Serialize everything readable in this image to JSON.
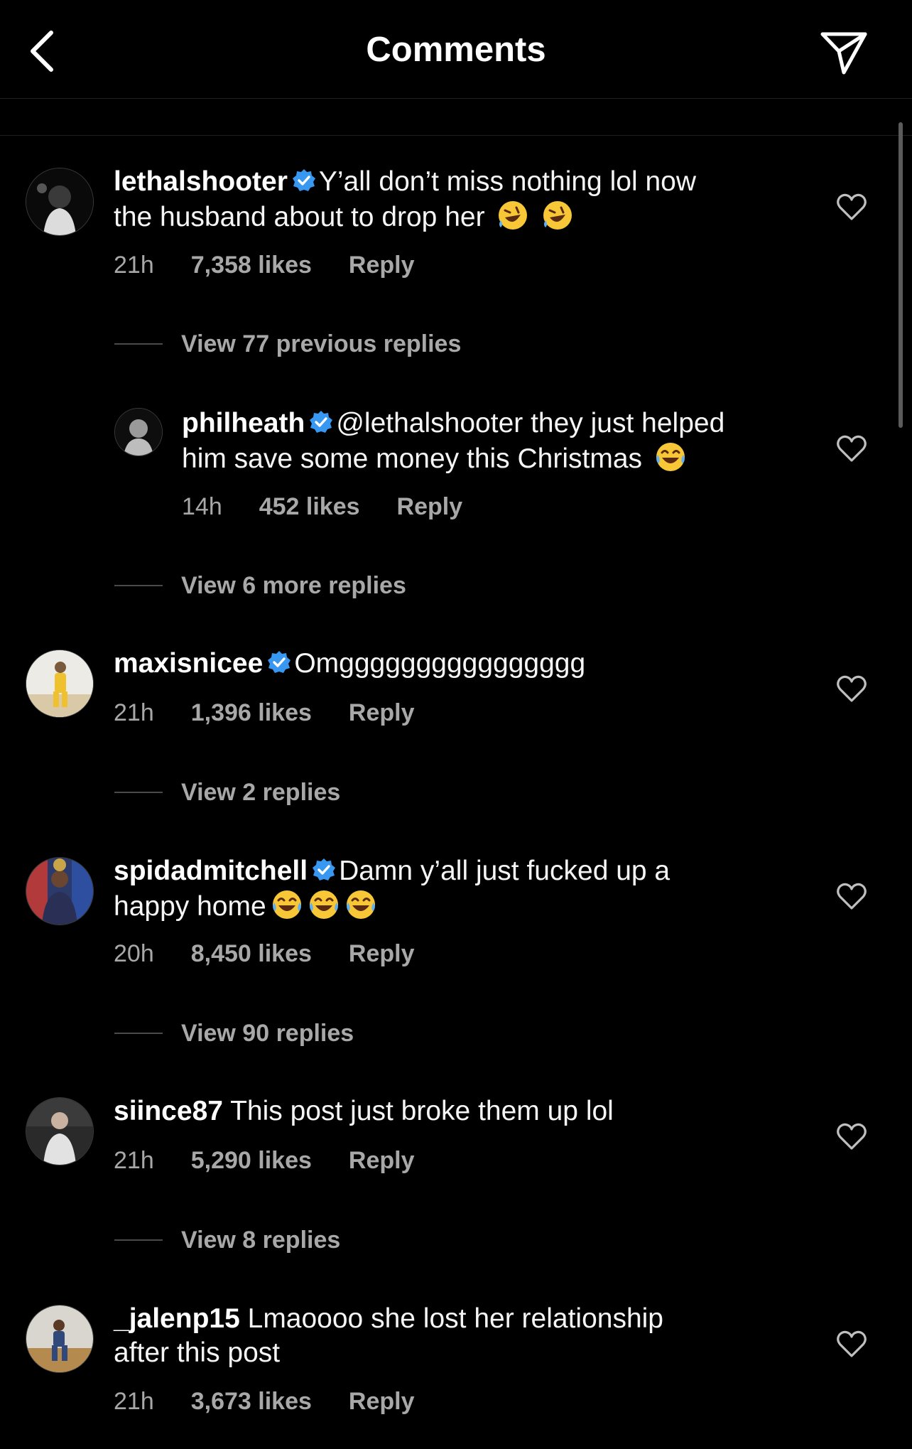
{
  "header": {
    "title": "Comments"
  },
  "comments": [
    {
      "username": "lethalshooter",
      "verified": true,
      "text_line1": "Y’all don’t miss nothing lol now",
      "text_line2": "the husband about to drop her",
      "emojis": [
        "rolling-on-floor-laughing",
        "rolling-on-floor-laughing"
      ],
      "time": "21h",
      "likes": "7,358 likes",
      "reply": "Reply",
      "view_replies": "View 77 previous replies"
    },
    {
      "username": "philheath",
      "verified": true,
      "text_line1": "@lethalshooter they just helped",
      "text_line2": "him save some money this Christmas",
      "emojis": [
        "tears-of-joy"
      ],
      "time": "14h",
      "likes": "452 likes",
      "reply": "Reply",
      "view_replies": "View 6 more replies"
    },
    {
      "username": "maxisnicee",
      "verified": true,
      "text_line1": "Omgggggggggggggggg",
      "time": "21h",
      "likes": "1,396 likes",
      "reply": "Reply",
      "view_replies": "View 2 replies"
    },
    {
      "username": "spidadmitchell",
      "verified": true,
      "text_line1": "Damn y’all just fucked up a",
      "text_line2": "happy home",
      "emojis": [
        "tears-of-joy",
        "tears-of-joy",
        "tears-of-joy"
      ],
      "time": "20h",
      "likes": "8,450 likes",
      "reply": "Reply",
      "view_replies": "View 90 replies"
    },
    {
      "username": "siince87",
      "verified": false,
      "text_line1": "This post just broke them up lol",
      "time": "21h",
      "likes": "5,290 likes",
      "reply": "Reply",
      "view_replies": "View 8 replies"
    },
    {
      "username": "_jalenp15",
      "verified": false,
      "text_line1": "Lmaoooo she lost her relationship",
      "text_line2": "after this post",
      "time": "21h",
      "likes": "3,673 likes",
      "reply": "Reply"
    }
  ],
  "icons": {
    "back": "chevron-left-icon",
    "share": "paper-plane-icon",
    "like": "heart-outline-icon",
    "verified": "verified-badge-icon"
  },
  "colors": {
    "background": "#000000",
    "text": "#f5f5f5",
    "secondary": "#a8a8a8",
    "verified": "#3897f0"
  }
}
